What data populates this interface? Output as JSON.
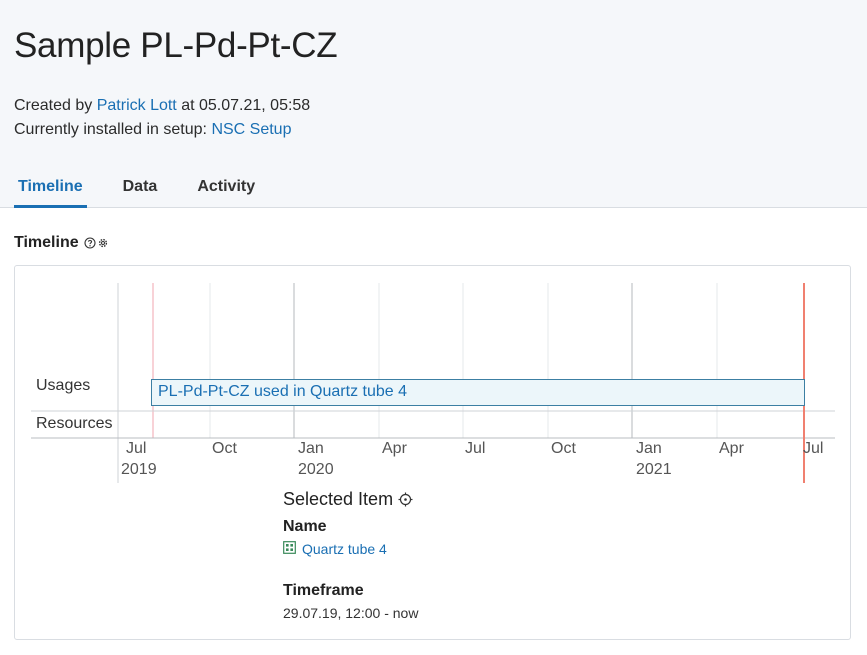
{
  "page": {
    "title": "Sample PL-Pd-Pt-CZ",
    "created_prefix": "Created by",
    "created_by": "Patrick Lott",
    "created_at": "at 05.07.21, 05:58",
    "setup_prefix": "Currently installed in setup:",
    "setup_name": "NSC Setup"
  },
  "tabs": [
    {
      "label": "Timeline",
      "active": true
    },
    {
      "label": "Data",
      "active": false
    },
    {
      "label": "Activity",
      "active": false
    }
  ],
  "timeline": {
    "section_title": "Timeline",
    "rows": {
      "usages": "Usages",
      "resources": "Resources"
    },
    "usage_bar_label": "PL-Pd-Pt-CZ used in Quartz tube 4",
    "ticks": [
      {
        "month": "Jul",
        "year": "2019"
      },
      {
        "month": "Oct",
        "year": ""
      },
      {
        "month": "Jan",
        "year": "2020"
      },
      {
        "month": "Apr",
        "year": ""
      },
      {
        "month": "Jul",
        "year": ""
      },
      {
        "month": "Oct",
        "year": ""
      },
      {
        "month": "Jan",
        "year": "2021"
      },
      {
        "month": "Apr",
        "year": ""
      },
      {
        "month": "Jul",
        "year": ""
      }
    ],
    "now_line_color": "#f08070",
    "start_line_color": "#f5b8c0"
  },
  "selected_item": {
    "title": "Selected Item",
    "name_label": "Name",
    "name_value": "Quartz tube 4",
    "timeframe_label": "Timeframe",
    "timeframe_value": "29.07.19, 12:00 - now"
  },
  "colors": {
    "accent": "#1a6fb3",
    "header_bg": "#f5f7fa"
  }
}
